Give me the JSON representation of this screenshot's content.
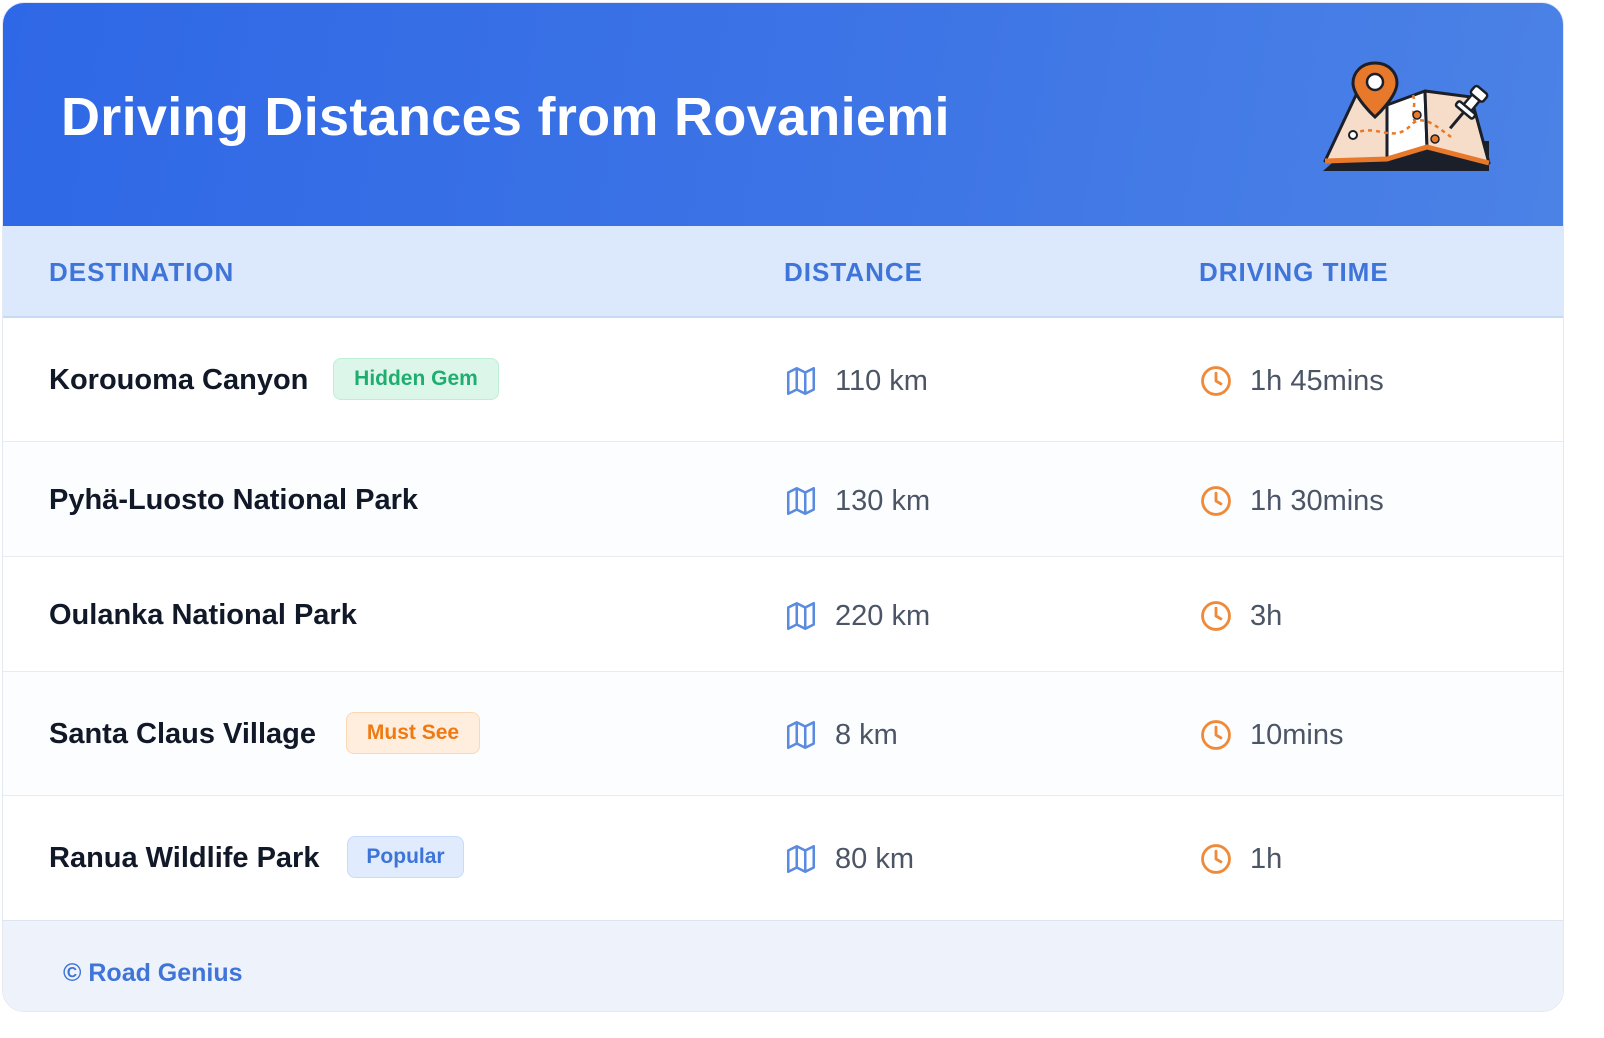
{
  "header": {
    "title": "Driving Distances from Rovaniemi",
    "illustration_icon": "folded-map-with-pins-icon"
  },
  "columns": {
    "destination": "DESTINATION",
    "distance": "DISTANCE",
    "driving_time": "DRIVING TIME"
  },
  "rows": [
    {
      "destination": "Korouoma Canyon",
      "badge": "Hidden Gem",
      "badge_color": "#1fae70",
      "distance": "110 km",
      "time": "1h 45mins"
    },
    {
      "destination": "Pyhä-Luosto National Park",
      "badge": "",
      "distance": "130 km",
      "time": "1h 30mins"
    },
    {
      "destination": "Oulanka National Park",
      "badge": "",
      "distance": "220 km",
      "time": "3h"
    },
    {
      "destination": "Santa Claus Village",
      "badge": "Must See",
      "badge_color": "#f07a12",
      "distance": "8 km",
      "time": "10mins"
    },
    {
      "destination": "Ranua Wildlife Park",
      "badge": "Popular",
      "badge_color": "#3e74d8",
      "distance": "80 km",
      "time": "1h"
    }
  ],
  "icons": {
    "distance": "map-icon",
    "time": "clock-icon"
  },
  "colors": {
    "header_blue": "#2f68e6",
    "accent_blue": "#3f74d8",
    "clock_orange": "#ef8a3a",
    "map_icon_blue": "#5b8be0"
  },
  "footer": {
    "credit": "© Road Genius"
  }
}
